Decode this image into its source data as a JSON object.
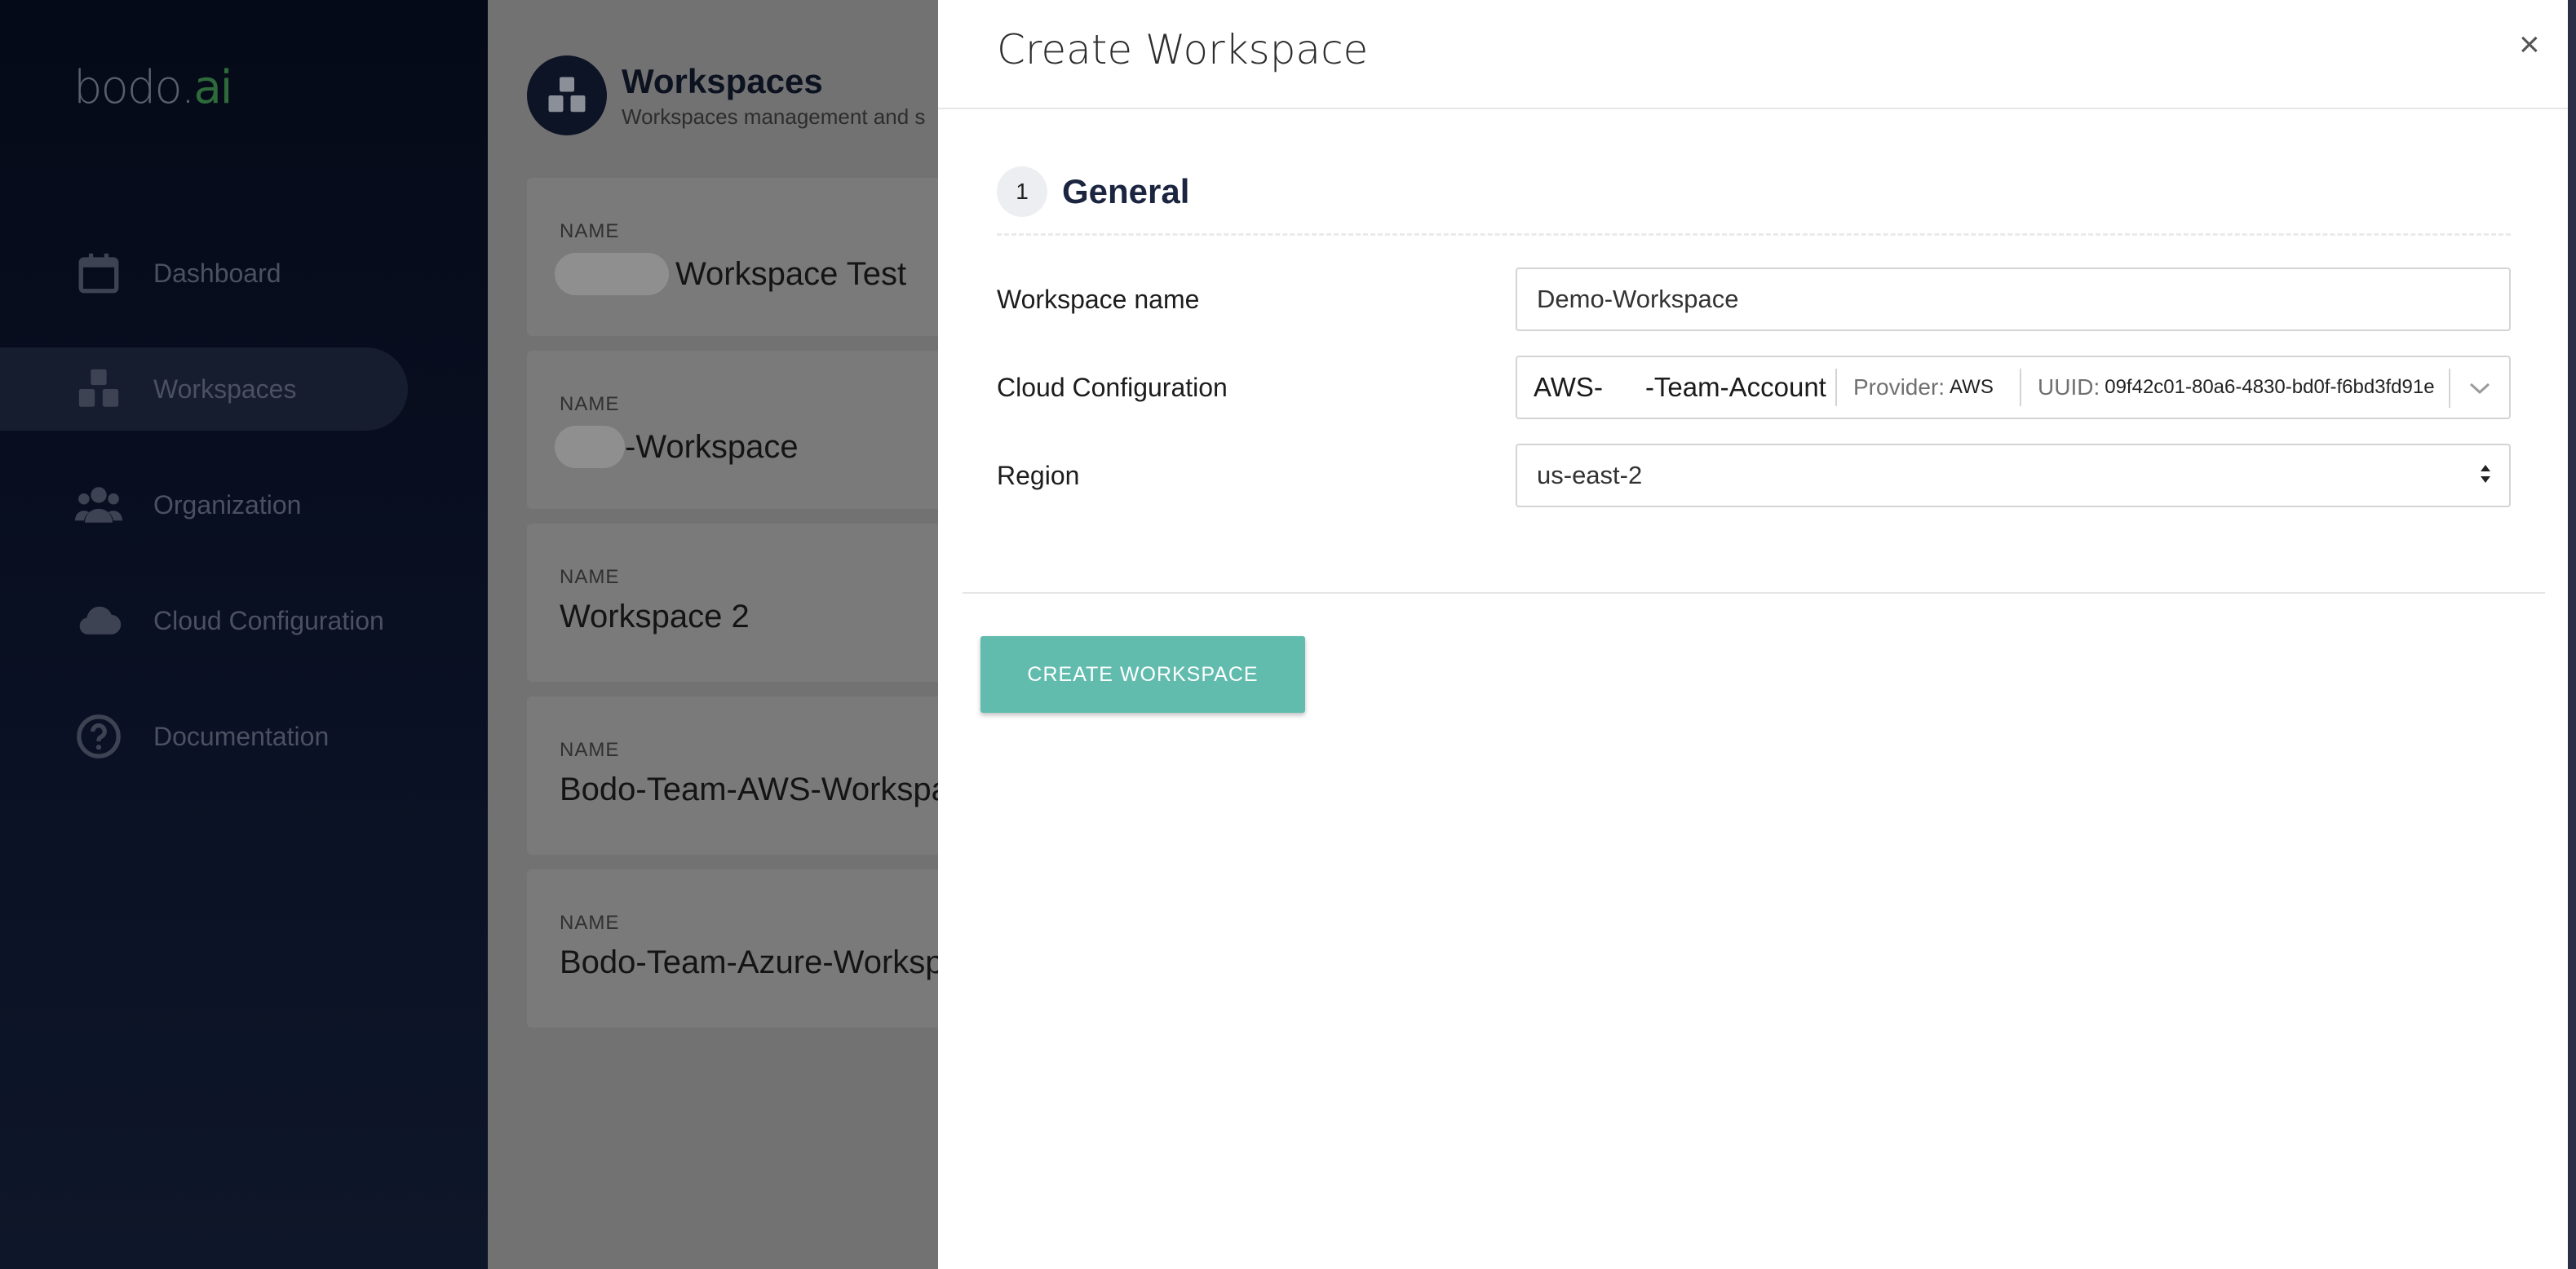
{
  "brand": {
    "logo_main": "bodo",
    "logo_dot": ".",
    "logo_accent": "ai"
  },
  "sidebar": {
    "items": [
      {
        "label": "Dashboard",
        "icon": "calendar-icon",
        "active": false
      },
      {
        "label": "Workspaces",
        "icon": "workspaces-icon",
        "active": true
      },
      {
        "label": "Organization",
        "icon": "users-icon",
        "active": false
      },
      {
        "label": "Cloud Configuration",
        "icon": "cloud-icon",
        "active": false
      },
      {
        "label": "Documentation",
        "icon": "help-circle-icon",
        "active": false
      }
    ]
  },
  "page": {
    "title": "Workspaces",
    "subtitle": "Workspaces management and s",
    "cards": [
      {
        "label": "NAME",
        "name": "Workspace Test"
      },
      {
        "label": "NAME",
        "name": "-Workspace"
      },
      {
        "label": "NAME",
        "name": "Workspace 2"
      },
      {
        "label": "NAME",
        "name": "Bodo-Team-AWS-Workspa"
      },
      {
        "label": "NAME",
        "name": "Bodo-Team-Azure-Worksp"
      }
    ]
  },
  "modal": {
    "title": "Create Workspace",
    "close_label": "×",
    "step_number": "1",
    "section_title": "General",
    "fields": {
      "workspace_name_label": "Workspace name",
      "workspace_name_value": "Demo-Workspace",
      "cloud_config_label": "Cloud Configuration",
      "cloud_config_name_prefix": "AWS-",
      "cloud_config_name_suffix": "-Team-Account",
      "provider_key": "Provider:",
      "provider_value": "AWS",
      "uuid_key": "UUID:",
      "uuid_value": "09f42c01-80a6-4830-bd0f-f6bd3fd91e",
      "region_label": "Region",
      "region_value": "us-east-2"
    },
    "submit_label": "CREATE WORKSPACE"
  },
  "colors": {
    "accent": "#62bcae",
    "sidebar_bg": "#050a18",
    "title": "#1b2540"
  }
}
